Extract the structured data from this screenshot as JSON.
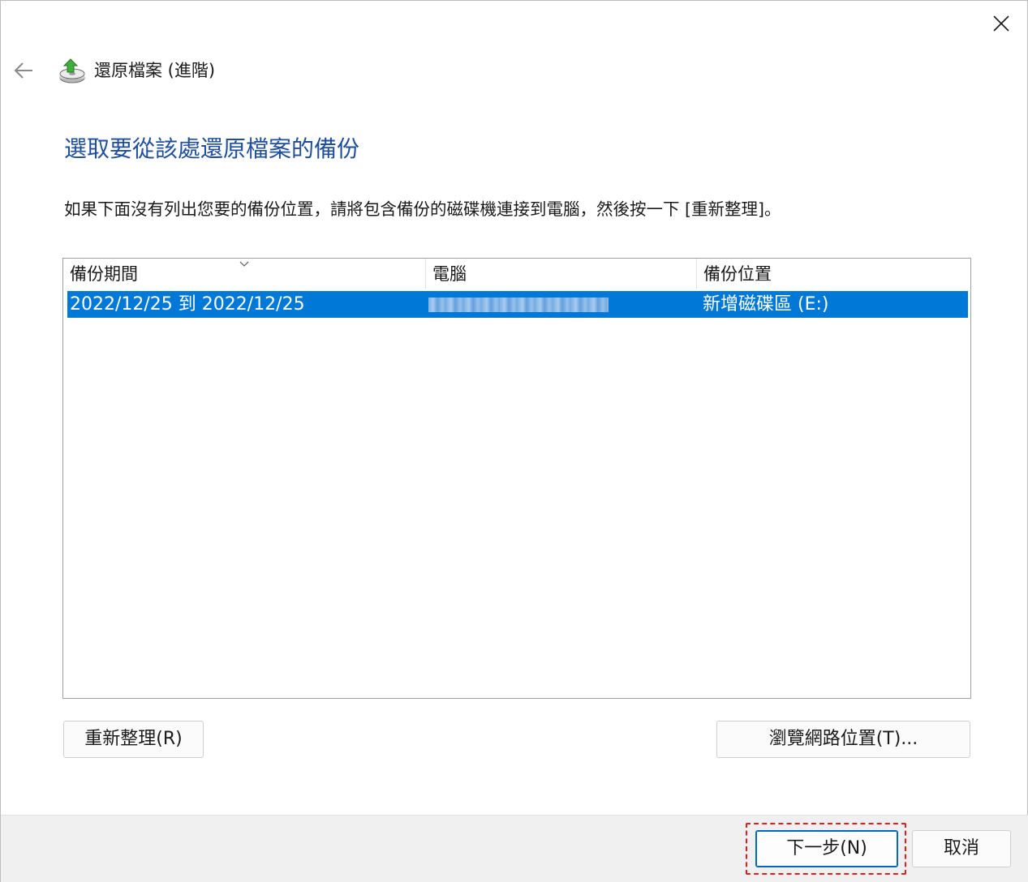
{
  "window": {
    "title": "還原檔案 (進階)"
  },
  "heading": "選取要從該處還原檔案的備份",
  "instructions": "如果下面沒有列出您要的備份位置，請將包含備份的磁碟機連接到電腦，然後按一下 [重新整理]。",
  "backup_list": {
    "columns": [
      "備份期間",
      "電腦",
      "備份位置"
    ],
    "sort_icon": "chevron-down-icon",
    "rows": [
      {
        "period": "2022/12/25 到 2022/12/25",
        "computer": "",
        "location": "新增磁碟區 (E:)",
        "selected": true
      }
    ]
  },
  "buttons": {
    "refresh": "重新整理(R)",
    "browse_network": "瀏覽網路位置(T)...",
    "next": "下一步(N)",
    "cancel": "取消"
  },
  "colors": {
    "heading": "#1f4e9c",
    "selection": "#0078d7",
    "highlight_annotation": "#e02020",
    "footer_bg": "#f0f0f0"
  }
}
